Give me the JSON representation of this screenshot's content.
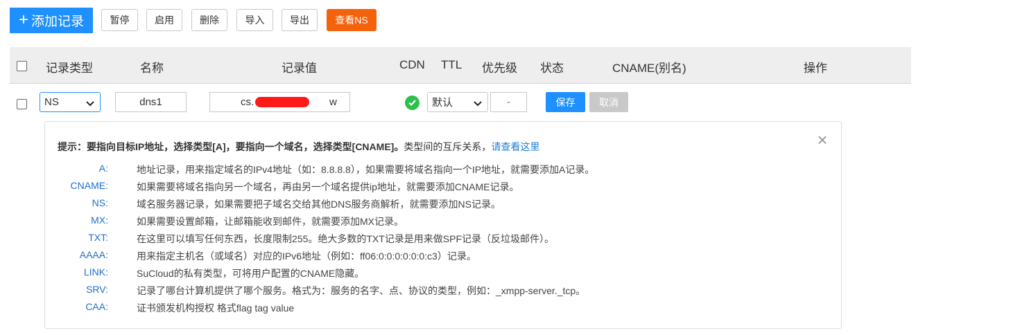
{
  "toolbar": {
    "add_label": "添加记录",
    "pause_label": "暂停",
    "enable_label": "启用",
    "delete_label": "删除",
    "import_label": "导入",
    "export_label": "导出",
    "view_ns_label": "查看NS"
  },
  "table": {
    "headers": {
      "type": "记录类型",
      "name": "名称",
      "value": "记录值",
      "cdn": "CDN",
      "ttl": "TTL",
      "priority": "优先级",
      "status": "状态",
      "cname": "CNAME(别名)",
      "actions": "操作"
    },
    "row": {
      "type_selected": "NS",
      "name_value": "dns1",
      "record_prefix": "cs.",
      "record_suffix": "w",
      "ttl_selected": "默认",
      "priority_value": "-",
      "save_label": "保存",
      "cancel_label": "取消"
    }
  },
  "tip": {
    "title_prefix": "提示：",
    "title_bold": "要指向目标IP地址，选择类型[A]，要指向一个域名，选择类型[CNAME]。",
    "title_tail": "类型间的互斥关系，",
    "link_label": "请查看这里",
    "close_icon": "×",
    "types": [
      {
        "key": "A:",
        "desc": "地址记录，用来指定域名的IPv4地址（如：8.8.8.8），如果需要将域名指向一个IP地址，就需要添加A记录。"
      },
      {
        "key": "CNAME:",
        "desc": "如果需要将域名指向另一个域名，再由另一个域名提供ip地址，就需要添加CNAME记录。"
      },
      {
        "key": "NS:",
        "desc": "域名服务器记录，如果需要把子域名交给其他DNS服务商解析，就需要添加NS记录。"
      },
      {
        "key": "MX:",
        "desc": "如果需要设置邮箱，让邮箱能收到邮件，就需要添加MX记录。"
      },
      {
        "key": "TXT:",
        "desc": "在这里可以填写任何东西，长度限制255。绝大多数的TXT记录是用来做SPF记录（反垃圾邮件）。"
      },
      {
        "key": "AAAA:",
        "desc": "用来指定主机名（或域名）对应的IPv6地址（例如：ff06:0:0:0:0:0:0:c3）记录。"
      },
      {
        "key": "LINK:",
        "desc": "SuCloud的私有类型，可将用户配置的CNAME隐藏。"
      },
      {
        "key": "SRV:",
        "desc": "记录了哪台计算机提供了哪个服务。格式为：服务的名字、点、协议的类型，例如：_xmpp-server._tcp。"
      },
      {
        "key": "CAA:",
        "desc": "证书颁发机构授权 格式flag tag value"
      }
    ]
  },
  "colors": {
    "primary": "#1e90ff",
    "orange": "#f4620c",
    "success": "#2dbf4c",
    "header_bg": "#eeeeee"
  }
}
